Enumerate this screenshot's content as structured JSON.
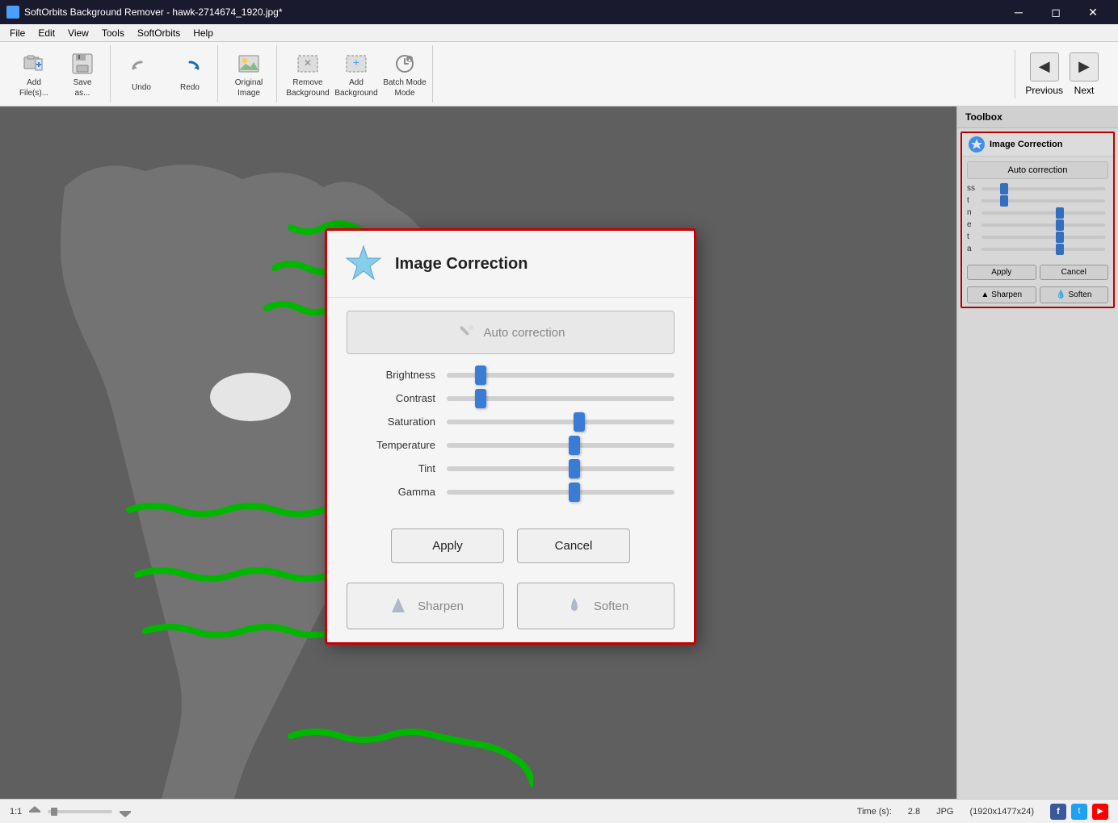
{
  "window": {
    "title": "SoftOrbits Background Remover - hawk-2714674_1920.jpg*",
    "controls": [
      "minimize",
      "maximize",
      "close"
    ]
  },
  "menu": {
    "items": [
      "File",
      "Edit",
      "View",
      "Tools",
      "SoftOrbits",
      "Help"
    ]
  },
  "toolbar": {
    "buttons": [
      {
        "id": "add-files",
        "label": "Add\nFile(s)...",
        "icon": "add-icon"
      },
      {
        "id": "save-as",
        "label": "Save\nas...",
        "icon": "save-icon"
      },
      {
        "id": "undo",
        "label": "Undo",
        "icon": "undo-icon"
      },
      {
        "id": "redo",
        "label": "Redo",
        "icon": "redo-icon"
      },
      {
        "id": "original-image",
        "label": "Original\nImage",
        "icon": "image-icon"
      },
      {
        "id": "remove-background",
        "label": "Remove\nBackground",
        "icon": "remove-icon"
      },
      {
        "id": "add-background",
        "label": "Add\nBackground",
        "icon": "add-bg-icon"
      },
      {
        "id": "batch-mode",
        "label": "Batch\nMode",
        "icon": "batch-icon"
      }
    ],
    "nav": {
      "previous_label": "Previous",
      "next_label": "Next"
    }
  },
  "toolbox": {
    "title": "Toolbox",
    "section": {
      "title": "Image Correction",
      "auto_correction_label": "Auto correction",
      "sliders": [
        {
          "label": "ss",
          "value": 20
        },
        {
          "label": "t",
          "value": 20
        },
        {
          "label": "n",
          "value": 60
        },
        {
          "label": "e",
          "value": 60
        },
        {
          "label": "t",
          "value": 60
        },
        {
          "label": "a",
          "value": 60
        }
      ],
      "apply_label": "Apply",
      "cancel_label": "Cancel",
      "sharpen_label": "Sharpen",
      "soften_label": "Soften"
    }
  },
  "modal": {
    "title": "Image Correction",
    "auto_correction_label": "Auto correction",
    "wand_icon": "wand-icon",
    "sliders": [
      {
        "label": "Brightness",
        "value": 15,
        "position": 15
      },
      {
        "label": "Contrast",
        "value": 15,
        "position": 15
      },
      {
        "label": "Saturation",
        "value": 58,
        "position": 58
      },
      {
        "label": "Temperature",
        "value": 56,
        "position": 56
      },
      {
        "label": "Tint",
        "value": 56,
        "position": 56
      },
      {
        "label": "Gamma",
        "value": 56,
        "position": 56
      }
    ],
    "apply_label": "Apply",
    "cancel_label": "Cancel",
    "sharpen_label": "Sharpen",
    "soften_label": "Soften"
  },
  "status_bar": {
    "zoom": "1:1",
    "time_label": "Time (s):",
    "time_value": "2.8",
    "format": "JPG",
    "dimensions": "(1920x1477x24)"
  }
}
